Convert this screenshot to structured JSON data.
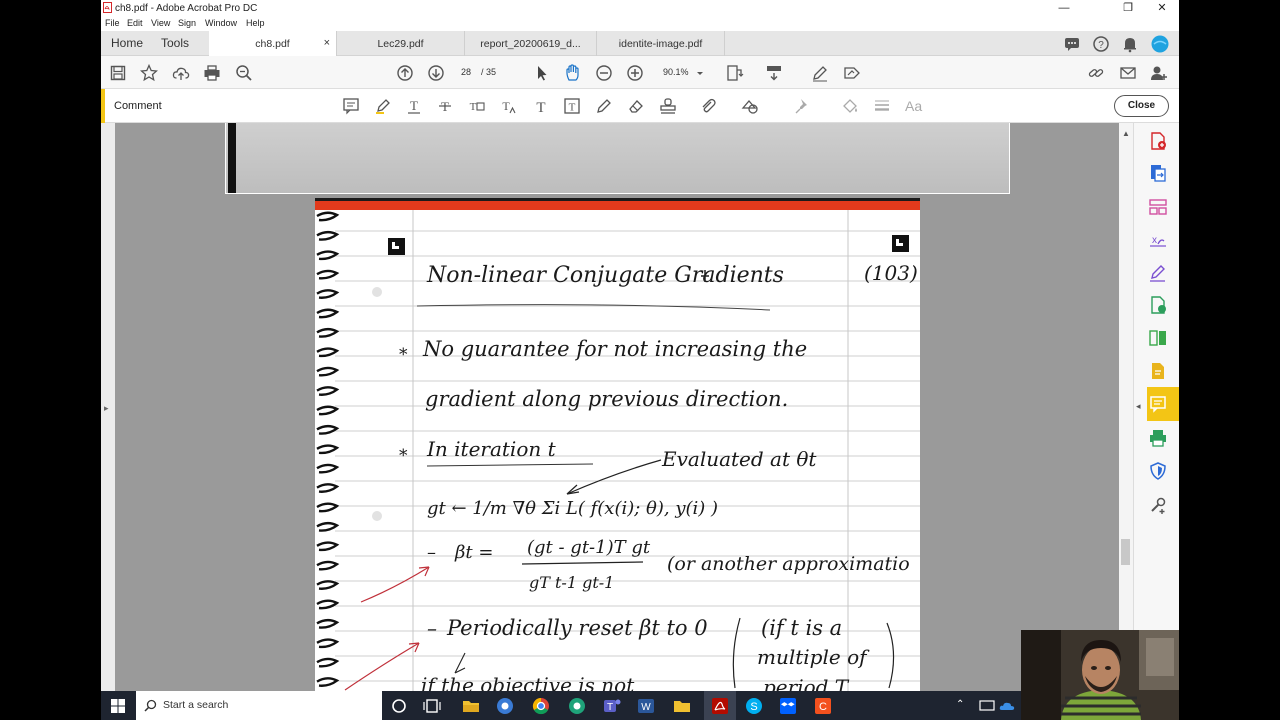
{
  "window": {
    "title": "ch8.pdf - Adobe Acrobat Pro DC",
    "controls": [
      "—",
      "❐",
      "✕"
    ]
  },
  "menu": [
    "File",
    "Edit",
    "View",
    "Sign",
    "Window",
    "Help"
  ],
  "tabs": {
    "home": "Home",
    "tools": "Tools",
    "documents": [
      {
        "label": "ch8.pdf",
        "active": true
      },
      {
        "label": "Lec29.pdf",
        "active": false
      },
      {
        "label": "report_20200619_d...",
        "active": false
      },
      {
        "label": "identite-image.pdf",
        "active": false
      }
    ],
    "close_glyph": "×"
  },
  "toolbar": {
    "page_current": "28",
    "page_total": "/ 35",
    "zoom": "90.1%"
  },
  "comment_bar": {
    "label": "Comment",
    "close_label": "Close",
    "text_tool": "Aa"
  },
  "note": {
    "title": "Non-linear Conjugate Gradients",
    "page_ref": "(103)",
    "bullet1_line1": "No guarantee for not increasing the",
    "bullet1_line2": "gradient along previous direction.",
    "bullet2": "In iteration t",
    "evaluated": "Evaluated at θt",
    "g_eq": "gt ← 1/m ∇θ Σi L( f(x(i); θ), y(i) )",
    "beta_lhs": "βt =",
    "beta_num": "(gt - gt-1)T gt",
    "beta_den": "gT t-1  gt-1",
    "beta_note": "(or another approximatio",
    "reset": "Periodically reset βt to 0",
    "reset_note1": "(if t is a",
    "reset_note2": "multiple of",
    "reset_note3": "period T",
    "objective": "if the objective is not"
  },
  "taskbar": {
    "search_placeholder": "Start a search"
  },
  "colors": {
    "accent_yellow": "#f3c515",
    "acrobat_red": "#d4272a",
    "taskbar": "#1e2430"
  }
}
